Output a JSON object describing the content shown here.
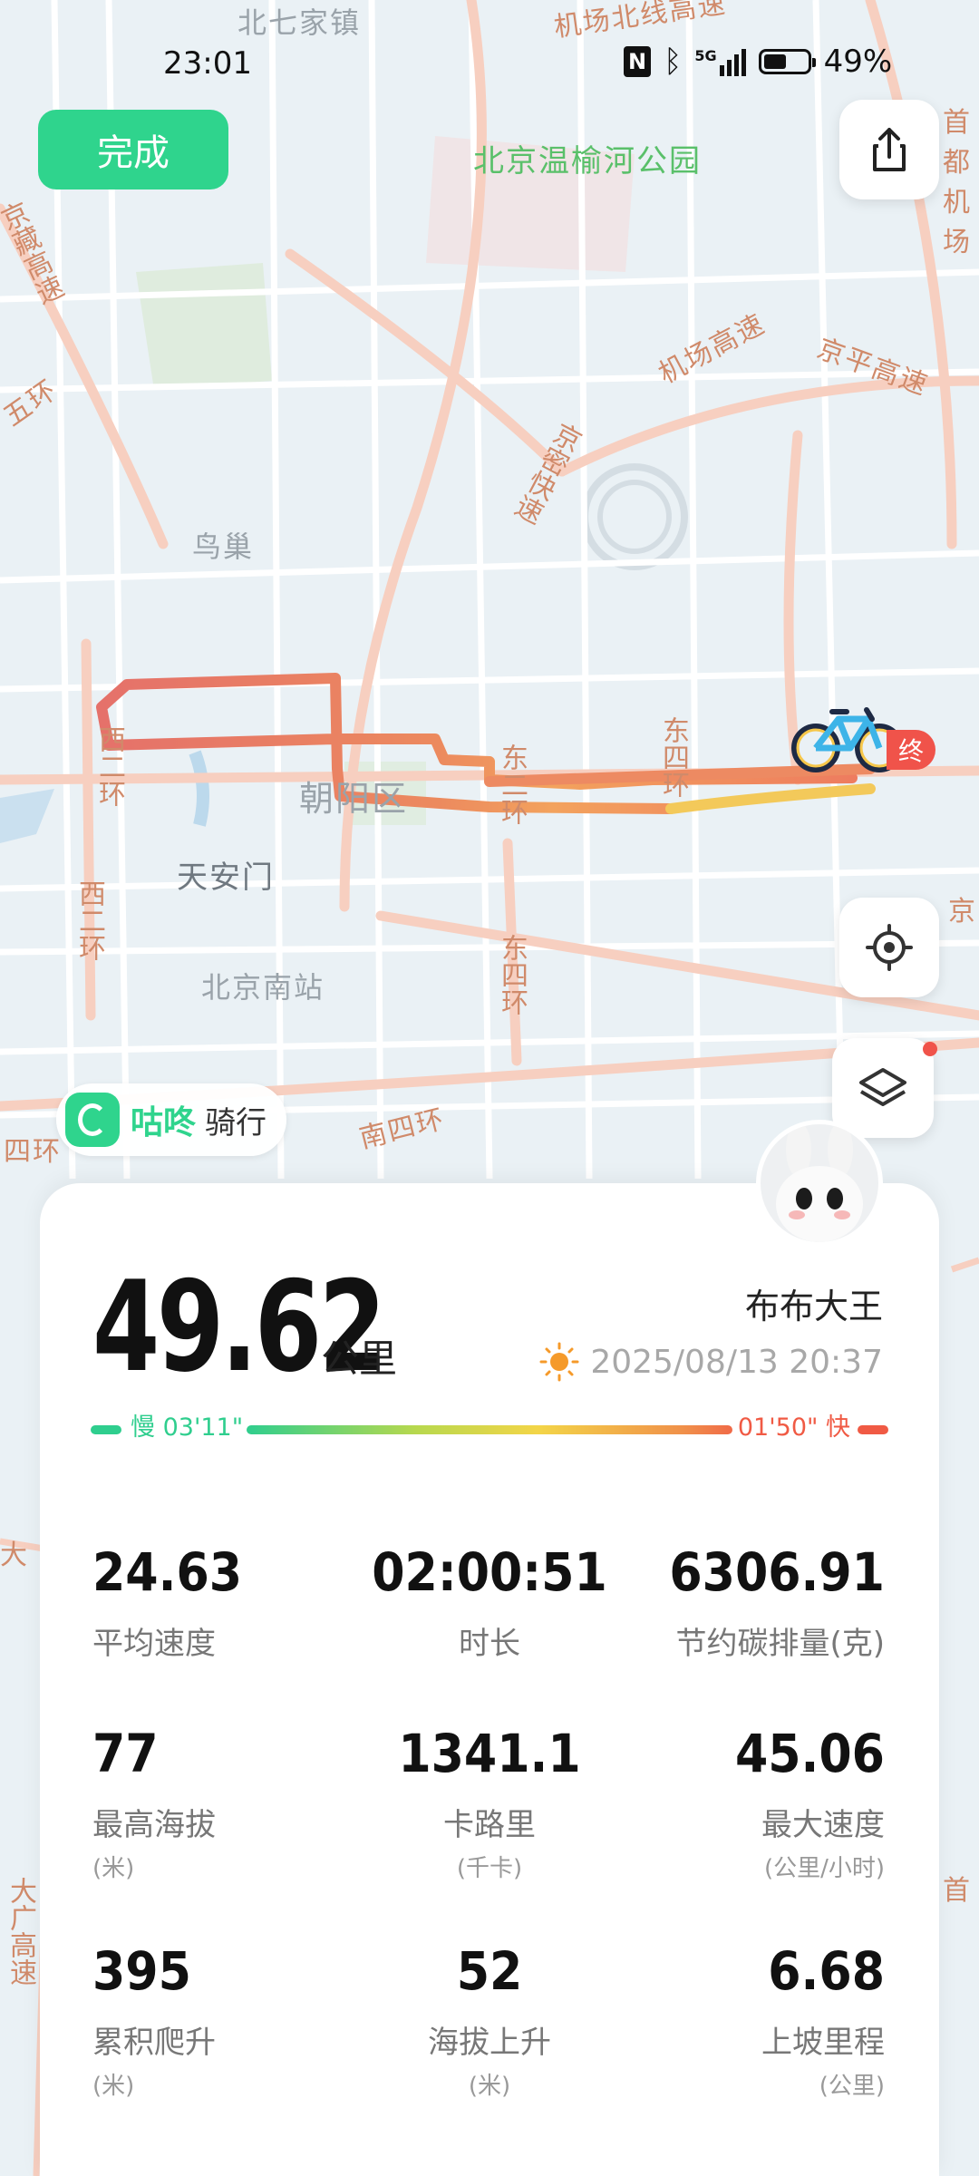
{
  "status_bar": {
    "time": "23:01",
    "battery": "49%",
    "network": "5G"
  },
  "header": {
    "done_label": "完成"
  },
  "map": {
    "labels": {
      "beiqijia": "北七家镇",
      "park": "北京温榆河公园",
      "nest": "鸟巢",
      "chaoyang": "朝阳区",
      "tiananmen": "天安门",
      "beijing_south": "北京南站",
      "south_4th": "南四环",
      "airport_expwy": "机场高速",
      "jingping_expwy": "京平高速",
      "jingmi_expwy": "京密快速",
      "airport_north": "机场北线高速",
      "east_2nd": "东二环",
      "east_3rd": "东四环",
      "east_4th": "东四环",
      "west_2nd_a": "西二环",
      "west_2nd_b": "西二环",
      "jingzang": "京藏高速",
      "fifth_ring": "五环",
      "capital": "首都机场",
      "daxing": "大广高速",
      "four_west": "四环",
      "da": "大",
      "jing": "京",
      "shou": "首"
    },
    "end_marker": "终",
    "route_colors": {
      "slow": "#f5d35a",
      "fast": "#ea6a5a"
    }
  },
  "brand": {
    "name": "咕咚",
    "activity": "骑行"
  },
  "summary": {
    "distance": "49.62",
    "distance_unit": "公里",
    "user": "布布大王",
    "datetime": "2025/08/13 20:37",
    "pace_slow": "慢 03'11\"",
    "pace_fast": "01'50\" 快"
  },
  "stats": [
    {
      "value": "24.63",
      "label": "平均速度",
      "unit": ""
    },
    {
      "value": "02:00:51",
      "label": "时长",
      "unit": ""
    },
    {
      "value": "6306.91",
      "label": "节约碳排量(克)",
      "unit": ""
    },
    {
      "value": "77",
      "label": "最高海拔",
      "unit": "(米)"
    },
    {
      "value": "1341.1",
      "label": "卡路里",
      "unit": "(千卡)"
    },
    {
      "value": "45.06",
      "label": "最大速度",
      "unit": "(公里/小时)"
    },
    {
      "value": "395",
      "label": "累积爬升",
      "unit": "(米)"
    },
    {
      "value": "52",
      "label": "海拔上升",
      "unit": "(米)"
    },
    {
      "value": "6.68",
      "label": "上坡里程",
      "unit": "(公里)"
    }
  ]
}
